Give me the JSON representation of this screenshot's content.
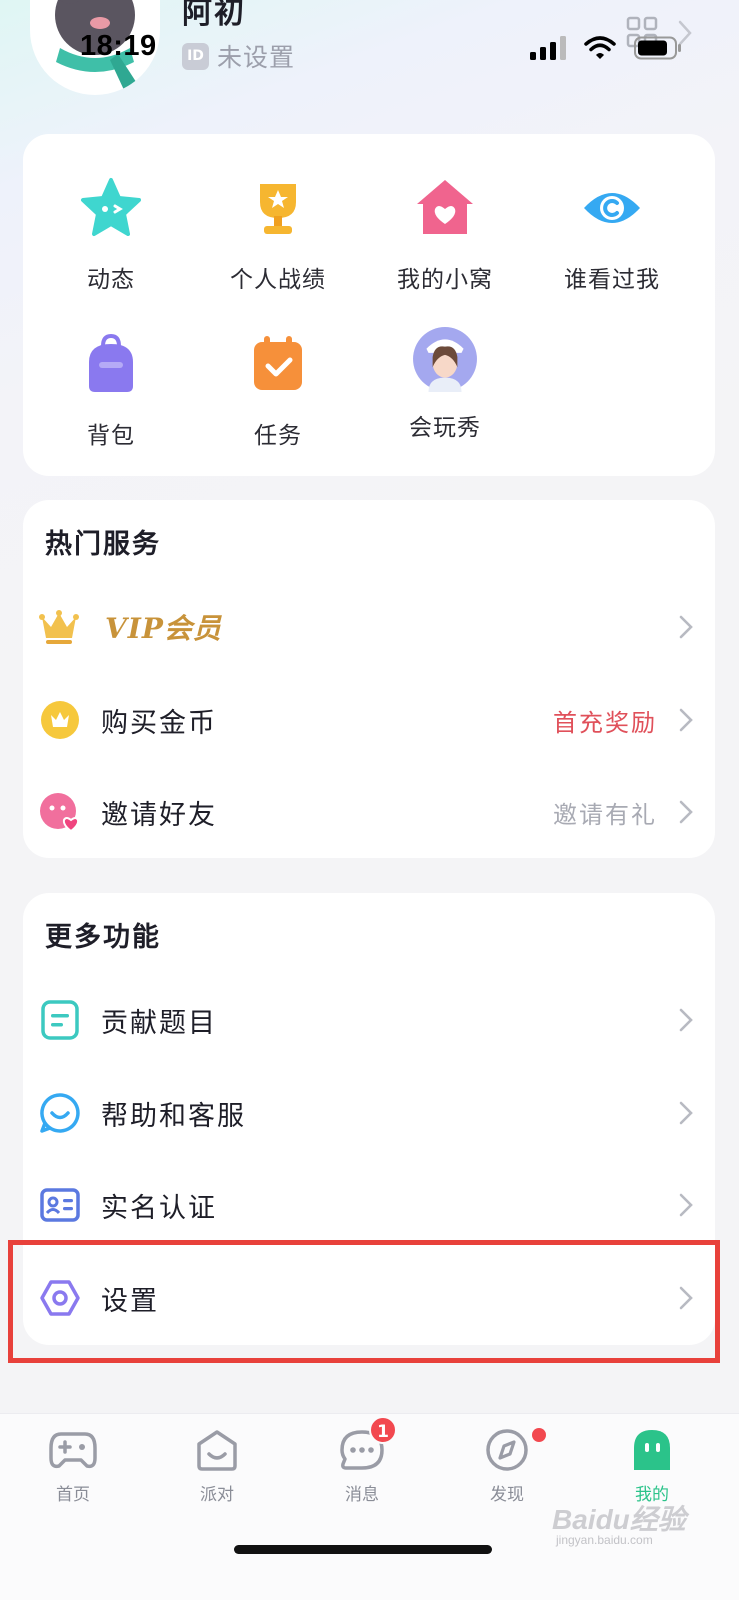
{
  "status_bar": {
    "time": "18:19"
  },
  "profile": {
    "nickname": "阿初",
    "id_badge": "ID",
    "id_value": "未设置"
  },
  "grid": [
    {
      "label": "动态",
      "icon": "star-face-icon",
      "color": "#3fd6cf"
    },
    {
      "label": "个人战绩",
      "icon": "trophy-icon",
      "color": "#f6b630"
    },
    {
      "label": "我的小窝",
      "icon": "house-heart-icon",
      "color": "#f0648e"
    },
    {
      "label": "谁看过我",
      "icon": "eye-icon",
      "color": "#35a9f2"
    },
    {
      "label": "背包",
      "icon": "backpack-icon",
      "color": "#8a79ef"
    },
    {
      "label": "任务",
      "icon": "calendar-check-icon",
      "color": "#f6903a"
    },
    {
      "label": "会玩秀",
      "icon": "avatar-show-icon",
      "color": "#9a9cf0"
    }
  ],
  "hot_services": {
    "title": "热门服务",
    "vip_label": "VIP会员",
    "items": [
      {
        "label": "购买金币",
        "extra": "首充奖励",
        "extra_color": "#e0505a"
      },
      {
        "label": "邀请好友",
        "extra": "邀请有礼",
        "extra_color": "#a8aab3"
      }
    ]
  },
  "more_features": {
    "title": "更多功能",
    "items": [
      {
        "label": "贡献题目"
      },
      {
        "label": "帮助和客服"
      },
      {
        "label": "实名认证"
      },
      {
        "label": "设置"
      }
    ]
  },
  "tabbar": {
    "items": [
      {
        "label": "首页"
      },
      {
        "label": "派对"
      },
      {
        "label": "消息",
        "badge": "1"
      },
      {
        "label": "发现"
      },
      {
        "label": "我的"
      }
    ]
  },
  "watermark": {
    "text": "Baidu经验",
    "sub": "jingyan.baidu.com"
  },
  "colors": {
    "accent_green": "#2bc38a",
    "badge_red": "#f2484f",
    "highlight_red": "#e8413b",
    "vip_gold": "#c8933a"
  }
}
